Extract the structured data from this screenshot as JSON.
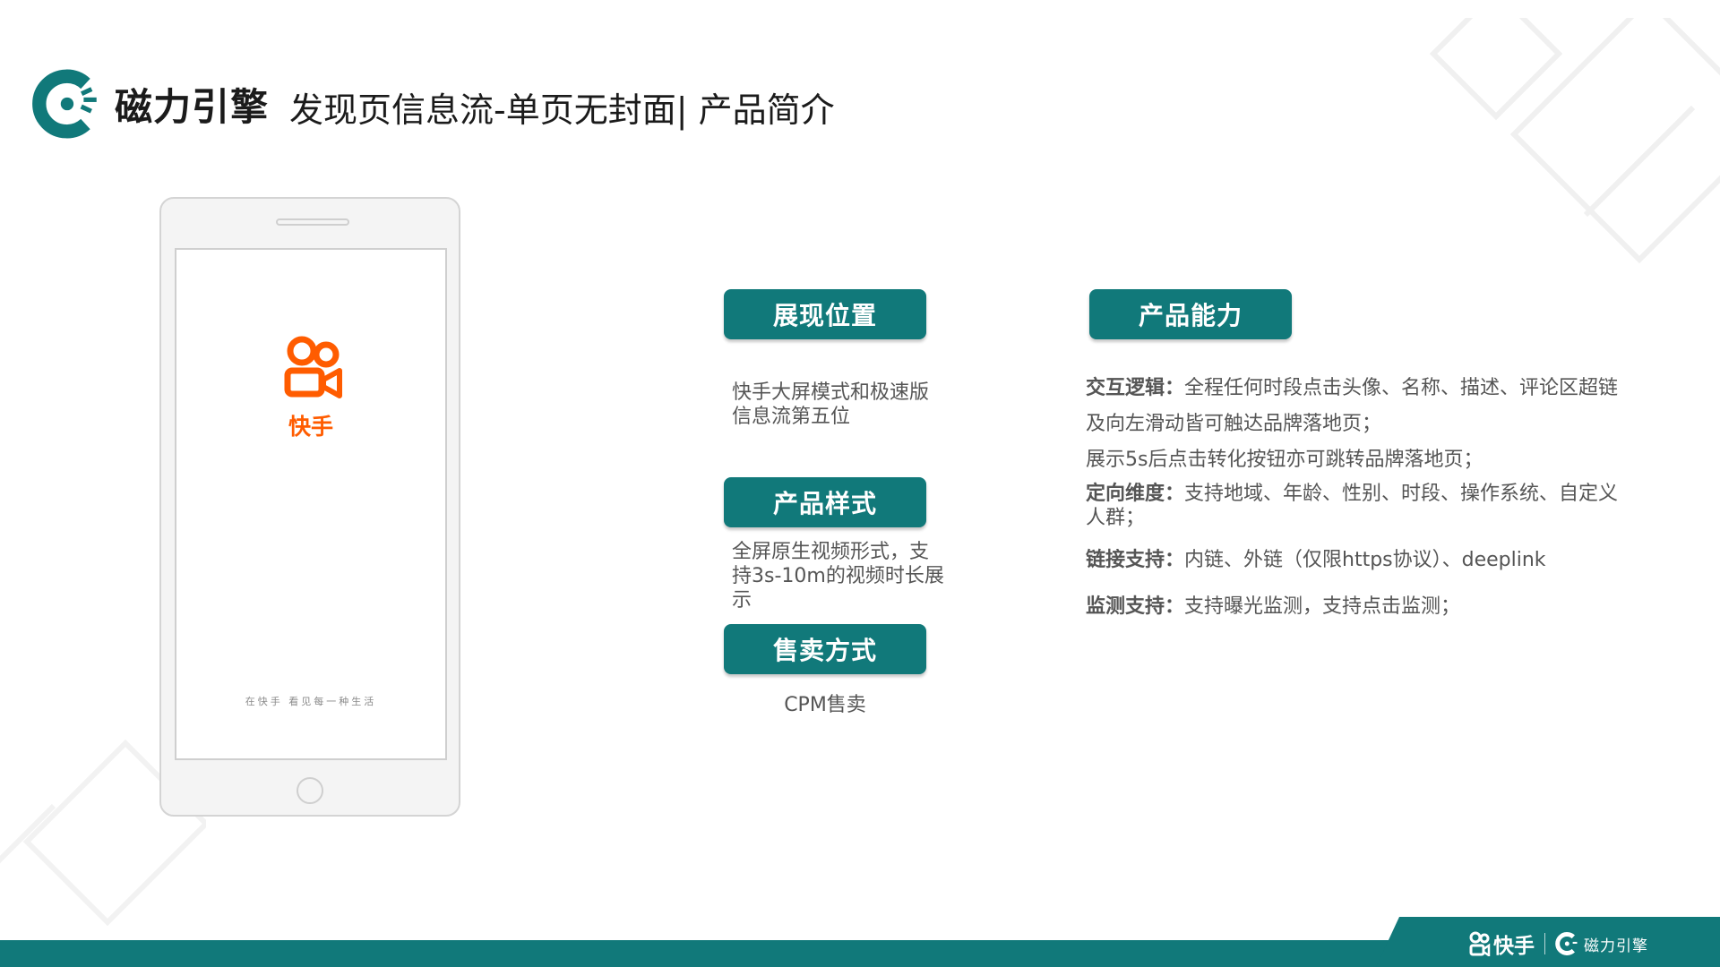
{
  "header": {
    "brand_name": "磁力引擎",
    "title": "发现页信息流-单页无封面| 产品简介"
  },
  "phone": {
    "app_name": "快手",
    "slogan": "在快手  看见每一种生活"
  },
  "sections": {
    "position": {
      "label": "展现位置",
      "text": "快手大屏模式和极速版信息流第五位"
    },
    "style": {
      "label": "产品样式",
      "text": "全屏原生视频形式，支持3s-10m的视频时长展示"
    },
    "sales": {
      "label": "售卖方式",
      "text": "CPM售卖"
    }
  },
  "capabilities": {
    "label": "产品能力",
    "interaction": {
      "key": "交互逻辑：",
      "line1": "全程任何时段点击头像、名称、描述、评论区超链及向左滑动皆可触达品牌落地页；",
      "line2": "展示5s后点击转化按钮亦可跳转品牌落地页；"
    },
    "targeting": {
      "key": "定向维度：",
      "value": "支持地域、年龄、性别、时段、操作系统、自定义人群；"
    },
    "link": {
      "key": "链接支持：",
      "value": "内链、外链（仅限https协议）、deeplink"
    },
    "monitor": {
      "key": "监测支持：",
      "value": "支持曝光监测，支持点击监测；"
    }
  },
  "footer": {
    "kuaishou": "快手",
    "cili": "磁力引擎"
  },
  "colors": {
    "teal": "#11797a",
    "kuaishou_orange": "#ff5c00",
    "body_text": "#555555"
  },
  "icons": [
    "cili-logo-icon",
    "kuaishou-logo-icon"
  ]
}
